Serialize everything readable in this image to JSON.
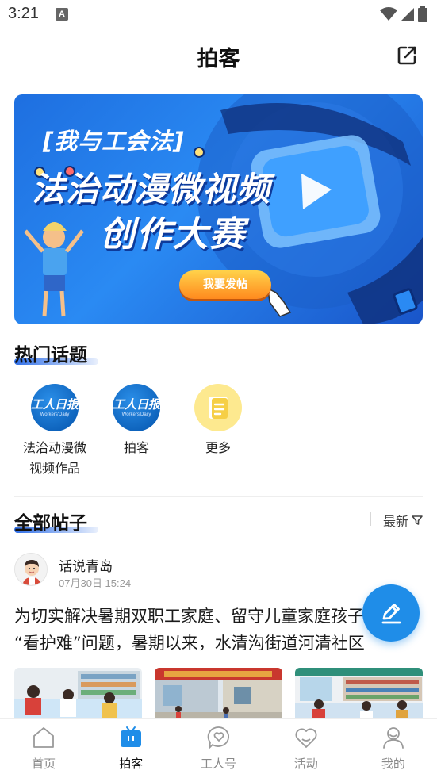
{
  "status_bar": {
    "time": "3:21",
    "notification_letter": "A"
  },
  "header": {
    "title": "拍客"
  },
  "banner": {
    "line1": "[我与工会法]",
    "line2": "法治动漫微视频",
    "line3": "创作大赛",
    "cta": "我要发帖"
  },
  "hot_topics": {
    "title": "热门话题",
    "items": [
      {
        "label_line1": "法治动漫微",
        "label_line2": "视频作品",
        "logo_text": "工人日报",
        "logo_sub": "Workers'Daily"
      },
      {
        "label_line1": "拍客",
        "label_line2": "",
        "logo_text": "工人日报",
        "logo_sub": "Workers'Daily"
      },
      {
        "label_line1": "更多",
        "label_line2": ""
      }
    ]
  },
  "all_posts": {
    "title": "全部帖子",
    "sort_label": "最新"
  },
  "post": {
    "author": "话说青岛",
    "time": "07月30日 15:24",
    "line1": "为切实解决暑期双职工家庭、留守儿童家庭孩子",
    "line2": "“看护难”问题，暑期以来，水清沟街道河清社区"
  },
  "tabbar": {
    "items": [
      {
        "label": "首页",
        "icon": "home-icon"
      },
      {
        "label": "拍客",
        "icon": "tv-icon"
      },
      {
        "label": "工人号",
        "icon": "heart-chat-icon"
      },
      {
        "label": "活动",
        "icon": "heart-icon"
      },
      {
        "label": "我的",
        "icon": "user-icon"
      }
    ],
    "active_index": 1
  },
  "colors": {
    "accent": "#1f8de8",
    "banner_blue": "#2a8af3",
    "cta_orange": "#ff8a1e"
  }
}
